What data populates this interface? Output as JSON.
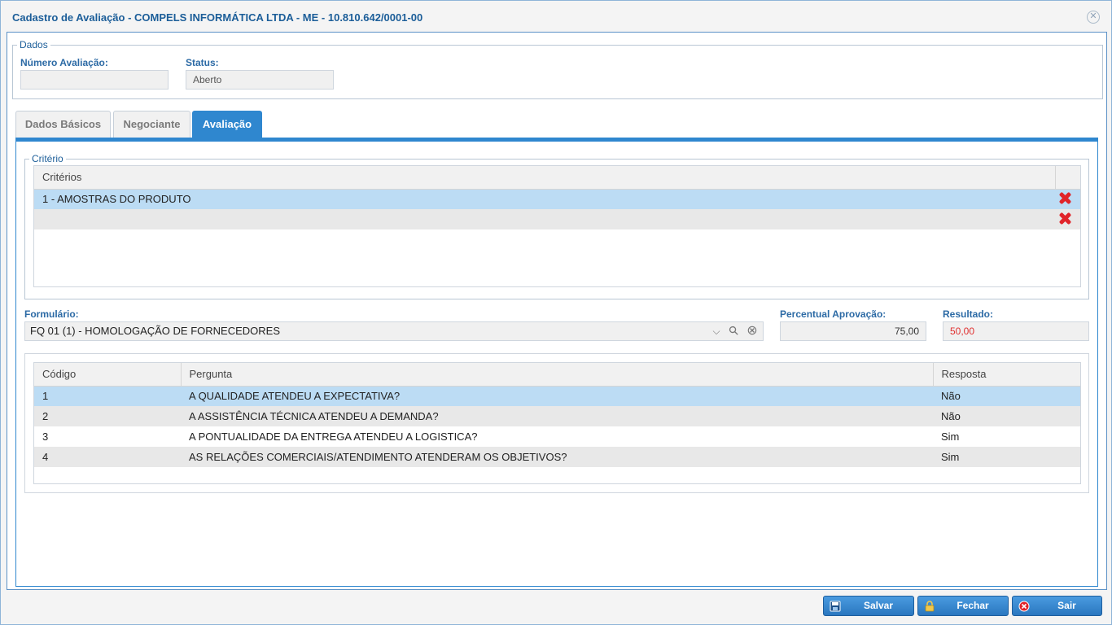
{
  "window": {
    "title": "Cadastro de Avaliação - COMPELS INFORMÁTICA LTDA - ME - 10.810.642/0001-00",
    "close_glyph": "✕"
  },
  "dados": {
    "legend": "Dados",
    "numero_label": "Número Avaliação:",
    "numero_value": "",
    "status_label": "Status:",
    "status_value": "Aberto"
  },
  "tabs": [
    {
      "label": "Dados Básicos",
      "active": false
    },
    {
      "label": "Negociante",
      "active": false
    },
    {
      "label": "Avaliação",
      "active": true
    }
  ],
  "criterio": {
    "legend": "Critério",
    "column_header": "Critérios",
    "rows": [
      {
        "text": "1 - AMOSTRAS DO PRODUTO"
      },
      {
        "text": ""
      }
    ]
  },
  "formulario": {
    "label": "Formulário:",
    "value": "FQ 01 (1) - HOMOLOGAÇÃO DE FORNECEDORES",
    "chevron_glyph": "⌵",
    "search_glyph": "⚲",
    "clear_glyph": "⊗"
  },
  "percentual": {
    "label": "Percentual Aprovação:",
    "value": "75,00"
  },
  "resultado": {
    "label": "Resultado:",
    "value": "50,00",
    "color": "#e03030"
  },
  "perguntas": {
    "headers": [
      "Código",
      "Pergunta",
      "Resposta"
    ],
    "rows": [
      {
        "codigo": "1",
        "pergunta": "A QUALIDADE ATENDEU A EXPECTATIVA?",
        "resposta": "Não"
      },
      {
        "codigo": "2",
        "pergunta": "A ASSISTÊNCIA TÉCNICA ATENDEU A DEMANDA?",
        "resposta": "Não"
      },
      {
        "codigo": "3",
        "pergunta": "A PONTUALIDADE DA ENTREGA ATENDEU A LOGISTICA?",
        "resposta": "Sim"
      },
      {
        "codigo": "4",
        "pergunta": "AS RELAÇÕES COMERCIAIS/ATENDIMENTO ATENDERAM OS OBJETIVOS?",
        "resposta": "Sim"
      }
    ]
  },
  "buttons": {
    "salvar": "Salvar",
    "fechar": "Fechar",
    "sair": "Sair"
  },
  "colors": {
    "accent": "#2f87cf",
    "title": "#1c5e99",
    "selected_row": "#bcdcf4",
    "delete_icon": "#e0242a"
  }
}
